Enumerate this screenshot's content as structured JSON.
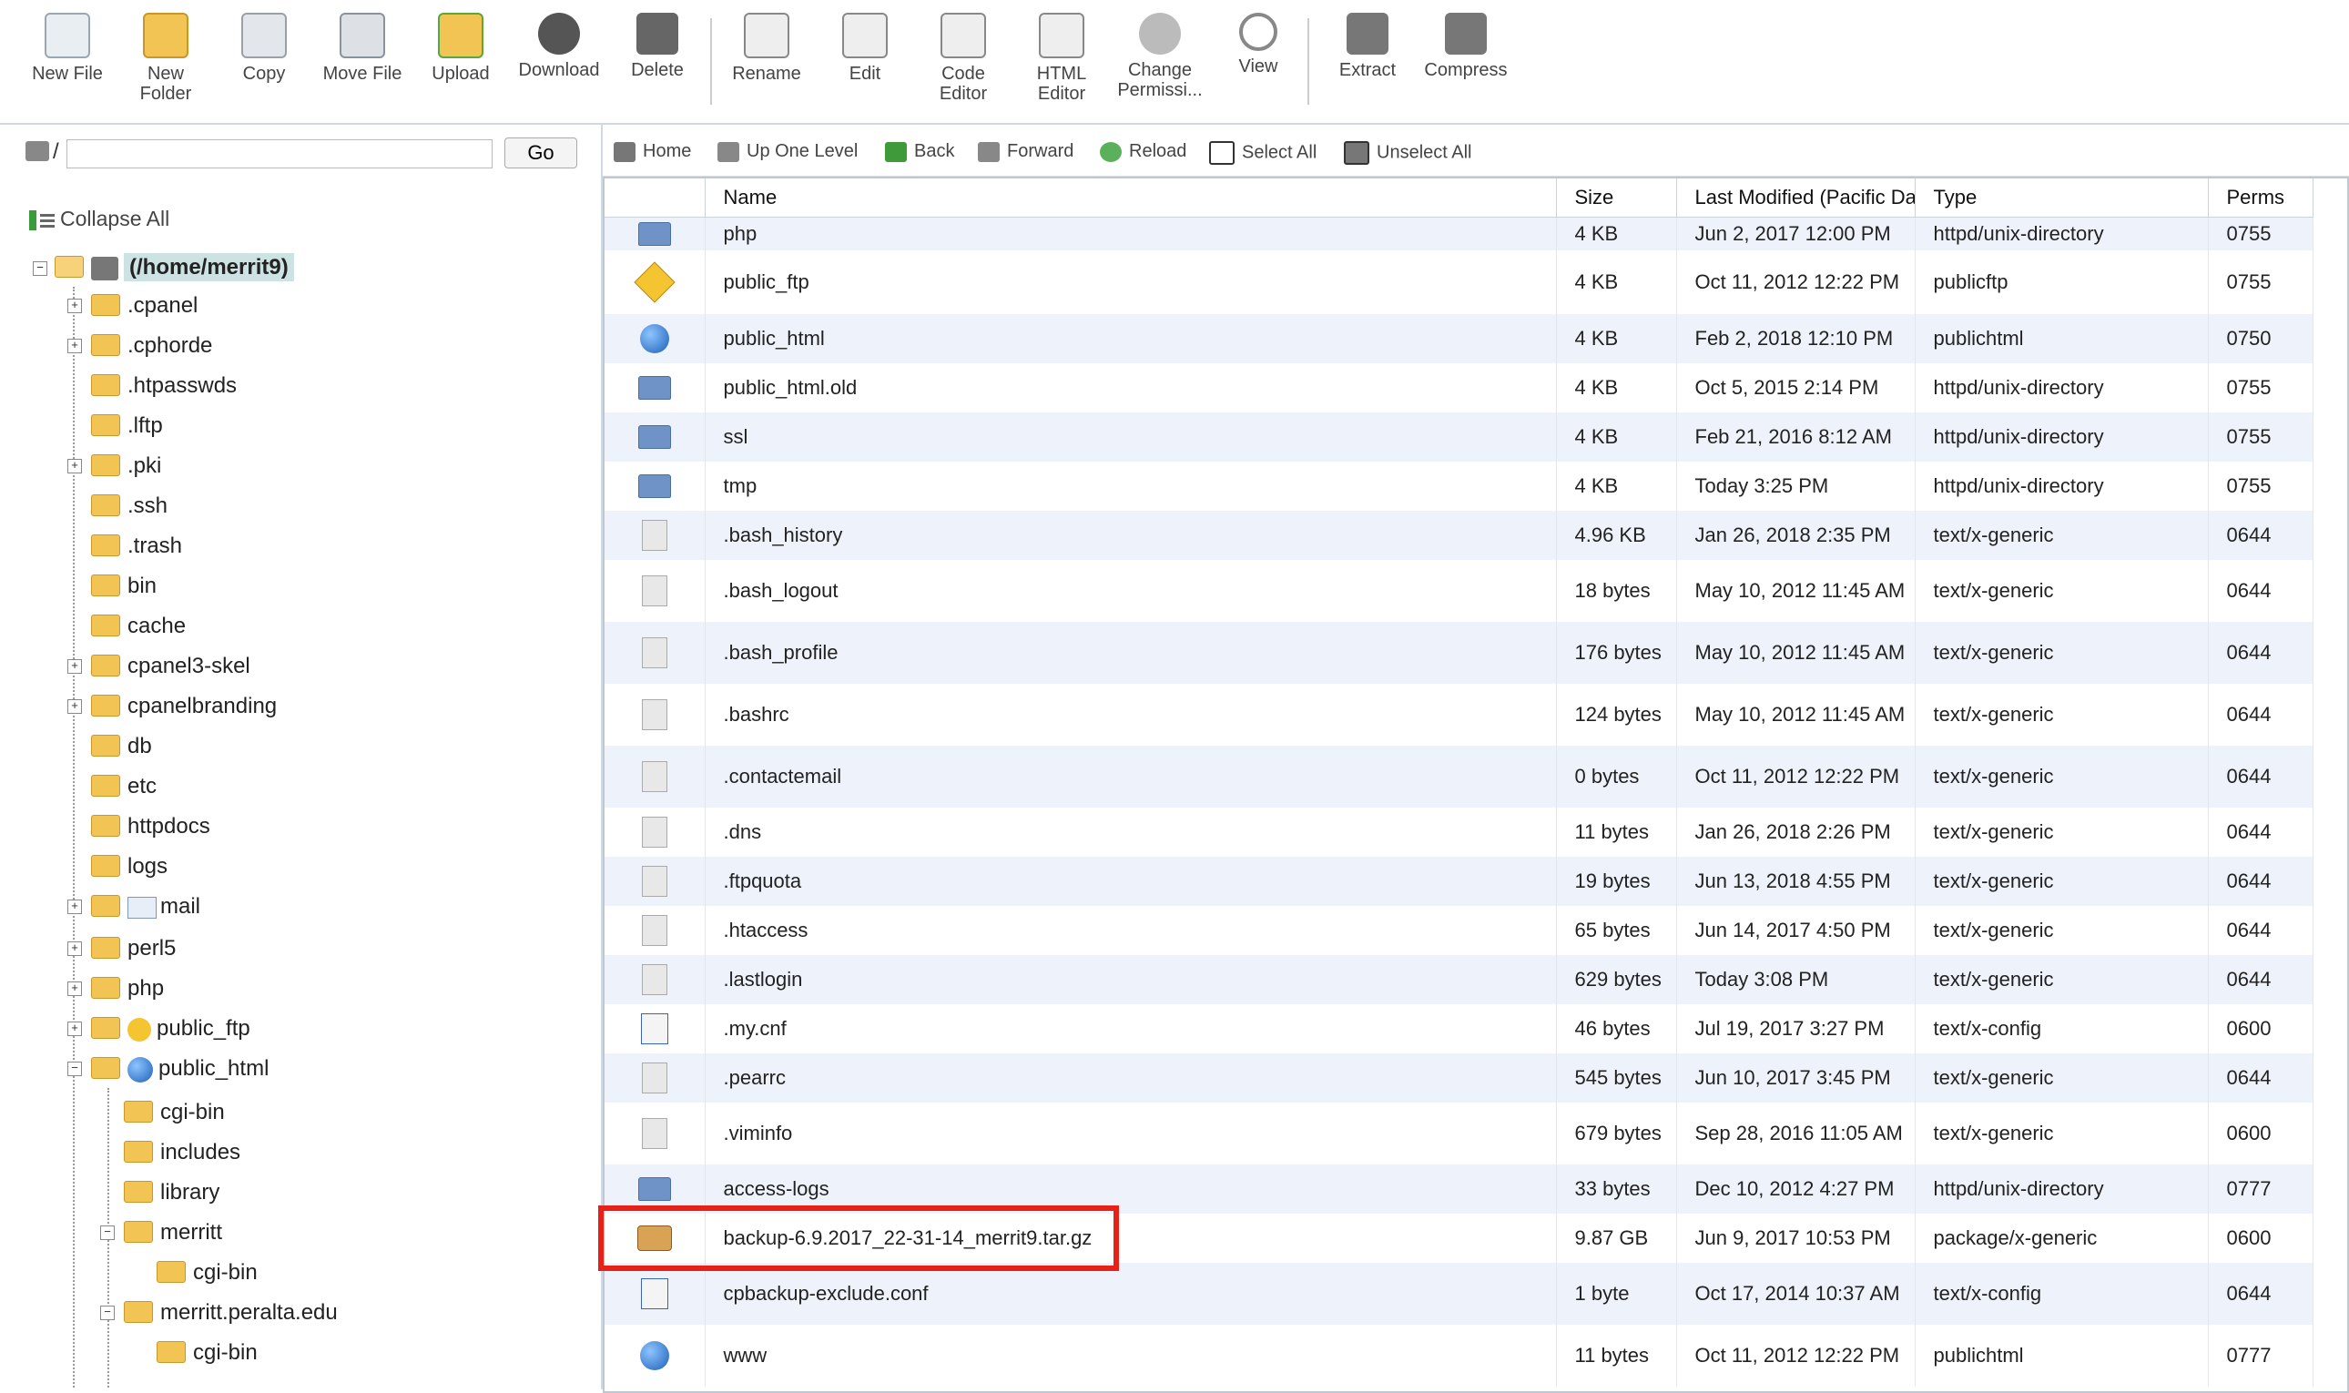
{
  "toolbar": {
    "buttons": [
      {
        "label": "New File",
        "icon": "new-file-icon"
      },
      {
        "label": "New\nFolder",
        "icon": "new-folder-icon"
      },
      {
        "label": "Copy",
        "icon": "copy-icon"
      },
      {
        "label": "Move File",
        "icon": "move-file-icon"
      },
      {
        "label": "Upload",
        "icon": "upload-icon"
      },
      {
        "label": "Download",
        "icon": "download-icon"
      },
      {
        "label": "Delete",
        "icon": "delete-icon"
      },
      {
        "label": "Rename",
        "icon": "rename-icon"
      },
      {
        "label": "Edit",
        "icon": "edit-icon"
      },
      {
        "label": "Code\nEditor",
        "icon": "code-editor-icon"
      },
      {
        "label": "HTML\nEditor",
        "icon": "html-editor-icon"
      },
      {
        "label": "Change\nPermissi...",
        "icon": "change-permissions-icon"
      },
      {
        "label": "View",
        "icon": "view-icon"
      },
      {
        "label": "Extract",
        "icon": "extract-icon"
      },
      {
        "label": "Compress",
        "icon": "compress-icon"
      }
    ]
  },
  "left": {
    "path_prefix": "/",
    "path_value": "",
    "go_label": "Go",
    "collapse_all": "Collapse All",
    "root_label": "(/home/merrit9)",
    "tree": [
      ".cpanel",
      ".cphorde",
      ".htpasswds",
      ".lftp",
      ".pki",
      ".ssh",
      ".trash",
      "bin",
      "cache",
      "cpanel3-skel",
      "cpanelbranding",
      "db",
      "etc",
      "httpdocs",
      "logs",
      "mail",
      "perl5",
      "php",
      "public_ftp",
      "public_html",
      "cgi-bin",
      "includes",
      "library",
      "merritt",
      "cgi-bin",
      "merritt.peralta.edu",
      "cgi-bin"
    ]
  },
  "nav": {
    "home": "Home",
    "up": "Up One Level",
    "back": "Back",
    "forward": "Forward",
    "reload": "Reload",
    "select_all": "Select All",
    "unselect_all": "Unselect All"
  },
  "table": {
    "headers": [
      "Name",
      "Size",
      "Last Modified (Pacific Da",
      "Type",
      "Perms"
    ],
    "rows": [
      {
        "icon": "folder",
        "name": "php",
        "size": "4 KB",
        "modified": "Jun 2, 2017 12:00 PM",
        "type": "httpd/unix-directory",
        "perms": "0755"
      },
      {
        "icon": "ftp",
        "name": "public_ftp",
        "size": "4 KB",
        "modified": "Oct 11, 2012 12:22 PM",
        "type": "publicftp",
        "perms": "0755"
      },
      {
        "icon": "globe",
        "name": "public_html",
        "size": "4 KB",
        "modified": "Feb 2, 2018 12:10 PM",
        "type": "publichtml",
        "perms": "0750"
      },
      {
        "icon": "folder",
        "name": "public_html.old",
        "size": "4 KB",
        "modified": "Oct 5, 2015 2:14 PM",
        "type": "httpd/unix-directory",
        "perms": "0755"
      },
      {
        "icon": "folder",
        "name": "ssl",
        "size": "4 KB",
        "modified": "Feb 21, 2016 8:12 AM",
        "type": "httpd/unix-directory",
        "perms": "0755"
      },
      {
        "icon": "folder",
        "name": "tmp",
        "size": "4 KB",
        "modified": "Today 3:25 PM",
        "type": "httpd/unix-directory",
        "perms": "0755"
      },
      {
        "icon": "file",
        "name": ".bash_history",
        "size": "4.96 KB",
        "modified": "Jan 26, 2018 2:35 PM",
        "type": "text/x-generic",
        "perms": "0644"
      },
      {
        "icon": "file",
        "name": ".bash_logout",
        "size": "18 bytes",
        "modified": "May 10, 2012 11:45 AM",
        "type": "text/x-generic",
        "perms": "0644"
      },
      {
        "icon": "file",
        "name": ".bash_profile",
        "size": "176 bytes",
        "modified": "May 10, 2012 11:45 AM",
        "type": "text/x-generic",
        "perms": "0644"
      },
      {
        "icon": "file",
        "name": ".bashrc",
        "size": "124 bytes",
        "modified": "May 10, 2012 11:45 AM",
        "type": "text/x-generic",
        "perms": "0644"
      },
      {
        "icon": "file",
        "name": ".contactemail",
        "size": "0 bytes",
        "modified": "Oct 11, 2012 12:22 PM",
        "type": "text/x-generic",
        "perms": "0644"
      },
      {
        "icon": "file",
        "name": ".dns",
        "size": "11 bytes",
        "modified": "Jan 26, 2018 2:26 PM",
        "type": "text/x-generic",
        "perms": "0644"
      },
      {
        "icon": "file",
        "name": ".ftpquota",
        "size": "19 bytes",
        "modified": "Jun 13, 2018 4:55 PM",
        "type": "text/x-generic",
        "perms": "0644"
      },
      {
        "icon": "file",
        "name": ".htaccess",
        "size": "65 bytes",
        "modified": "Jun 14, 2017 4:50 PM",
        "type": "text/x-generic",
        "perms": "0644"
      },
      {
        "icon": "file",
        "name": ".lastlogin",
        "size": "629 bytes",
        "modified": "Today 3:08 PM",
        "type": "text/x-generic",
        "perms": "0644"
      },
      {
        "icon": "config",
        "name": ".my.cnf",
        "size": "46 bytes",
        "modified": "Jul 19, 2017 3:27 PM",
        "type": "text/x-config",
        "perms": "0600"
      },
      {
        "icon": "file",
        "name": ".pearrc",
        "size": "545 bytes",
        "modified": "Jun 10, 2017 3:45 PM",
        "type": "text/x-generic",
        "perms": "0644"
      },
      {
        "icon": "file",
        "name": ".viminfo",
        "size": "679 bytes",
        "modified": "Sep 28, 2016 11:05 AM",
        "type": "text/x-generic",
        "perms": "0600"
      },
      {
        "icon": "folder",
        "name": "access-logs",
        "size": "33 bytes",
        "modified": "Dec 10, 2012 4:27 PM",
        "type": "httpd/unix-directory",
        "perms": "0777"
      },
      {
        "icon": "package",
        "name": "backup-6.9.2017_22-31-14_merrit9.tar.gz",
        "size": "9.87 GB",
        "modified": "Jun 9, 2017 10:53 PM",
        "type": "package/x-generic",
        "perms": "0600"
      },
      {
        "icon": "config",
        "name": "cpbackup-exclude.conf",
        "size": "1 byte",
        "modified": "Oct 17, 2014 10:37 AM",
        "type": "text/x-config",
        "perms": "0644"
      },
      {
        "icon": "globe",
        "name": "www",
        "size": "11 bytes",
        "modified": "Oct 11, 2012 12:22 PM",
        "type": "publichtml",
        "perms": "0777"
      }
    ]
  },
  "colors": {
    "row_stripe": "#eef3fb",
    "highlight": "#e62117",
    "folder_icon": "#6f93c7"
  }
}
